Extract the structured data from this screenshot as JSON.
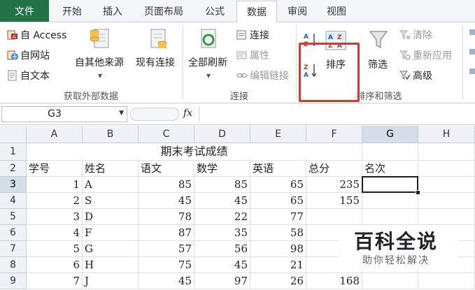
{
  "tabs": {
    "file": "文件",
    "items": [
      "开始",
      "插入",
      "页面布局",
      "公式",
      "数据",
      "审阅",
      "视图"
    ],
    "active": "数据"
  },
  "ribbon": {
    "get_external": {
      "label": "获取外部数据",
      "access": "自 Access",
      "web": "自网站",
      "text": "自文本",
      "other": "自其他来源",
      "existing": "现有连接"
    },
    "connections": {
      "label": "连接",
      "refresh_all": "全部刷新",
      "connections": "连接",
      "properties": "属性",
      "edit_links": "编辑链接"
    },
    "sort_filter": {
      "label": "排序和筛选",
      "sort": "排序",
      "filter": "筛选",
      "clear": "清除",
      "reapply": "重新应用",
      "advanced": "高级"
    }
  },
  "formula_bar": {
    "name_box": "G3",
    "fx": "fx",
    "formula": ""
  },
  "sheet": {
    "columns": [
      "A",
      "B",
      "C",
      "D",
      "E",
      "F",
      "G",
      "H"
    ],
    "rows": [
      "1",
      "2",
      "3",
      "4",
      "5",
      "6",
      "7",
      "8",
      "9"
    ],
    "title": "期末考试成绩",
    "headers": [
      "学号",
      "姓名",
      "语文",
      "数学",
      "英语",
      "总分",
      "名次"
    ],
    "data": [
      [
        "1",
        "A",
        "85",
        "85",
        "65",
        "235"
      ],
      [
        "2",
        "S",
        "45",
        "45",
        "65",
        "155"
      ],
      [
        "3",
        "D",
        "78",
        "22",
        "77",
        ""
      ],
      [
        "4",
        "F",
        "87",
        "35",
        "58",
        ""
      ],
      [
        "5",
        "G",
        "57",
        "56",
        "98",
        ""
      ],
      [
        "6",
        "H",
        "75",
        "45",
        "21",
        ""
      ],
      [
        "7",
        "J",
        "45",
        "97",
        "26",
        "168"
      ]
    ],
    "active_cell": "G3"
  },
  "watermark": {
    "main": "百科全说",
    "sub": "助你轻松解决"
  },
  "colors": {
    "file_tab": "#217346",
    "highlight": "#e3322b"
  }
}
